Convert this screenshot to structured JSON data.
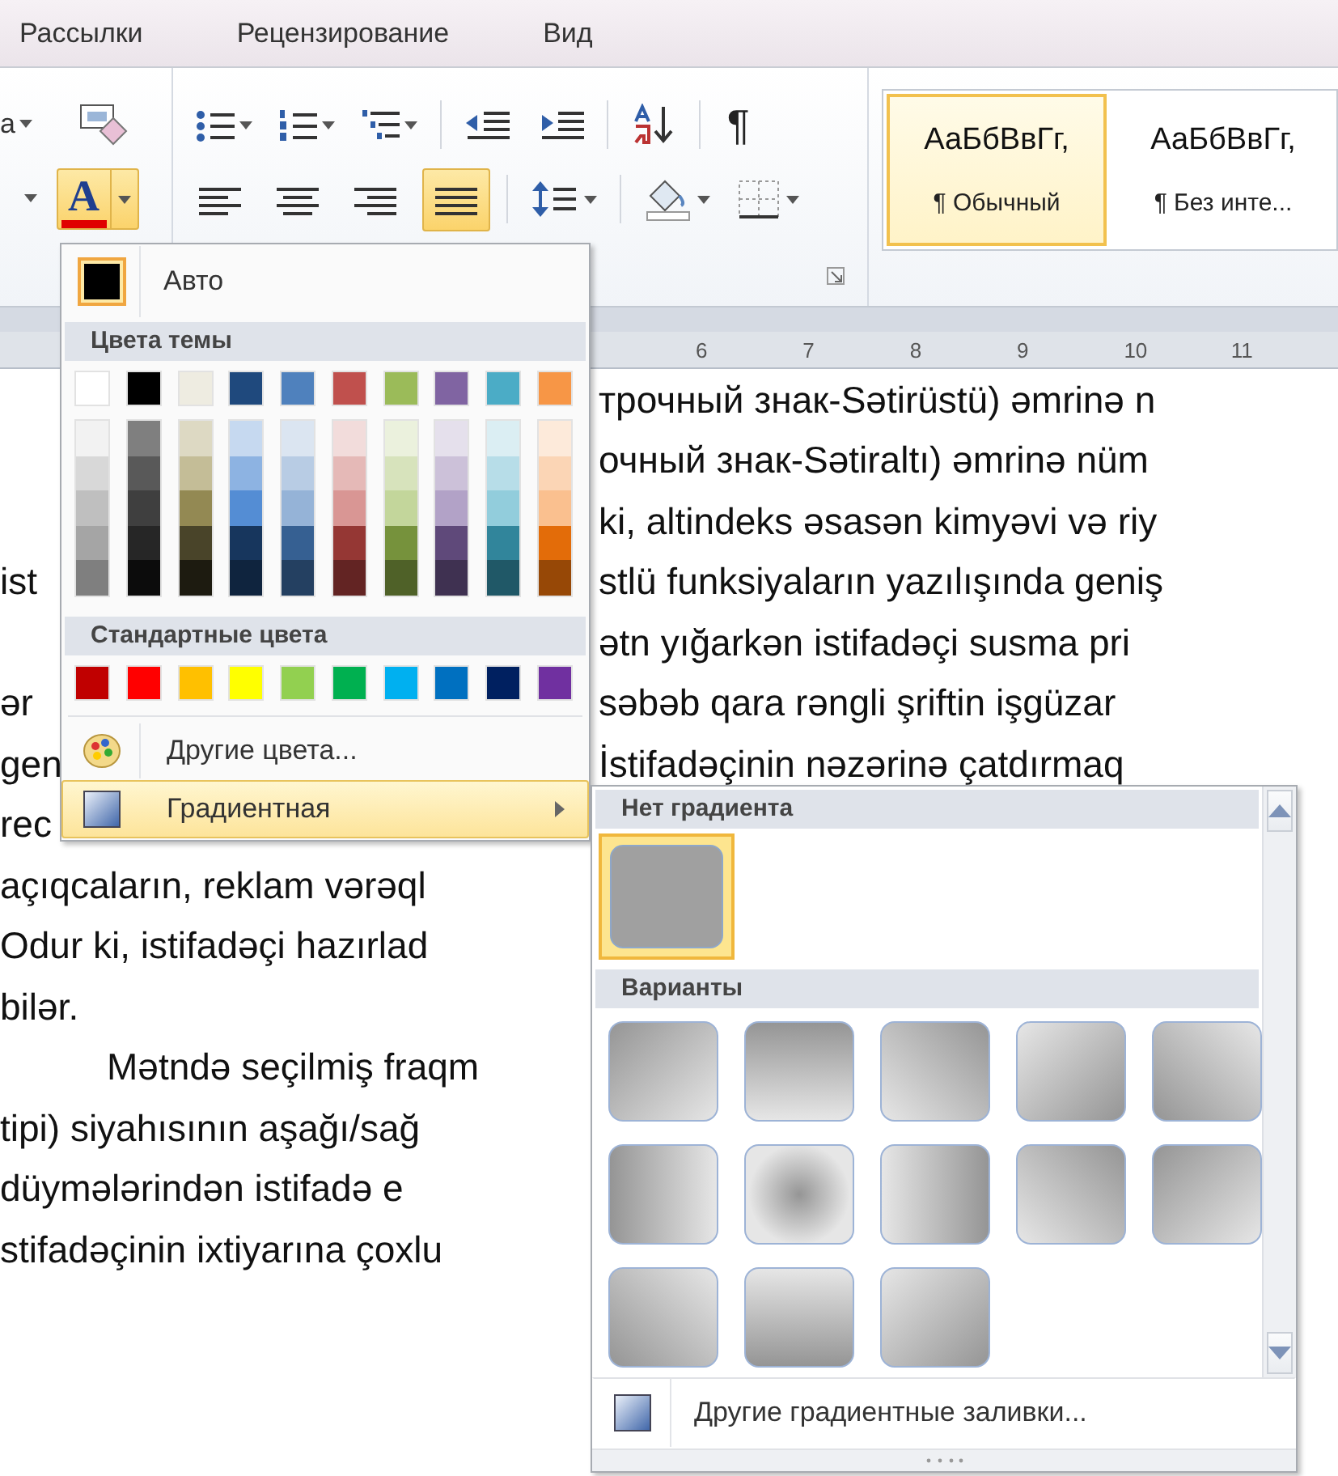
{
  "ribbon_tabs": [
    {
      "label": "Рассылки",
      "selected": false
    },
    {
      "label": "Рецензирование",
      "selected": false
    },
    {
      "label": "Вид",
      "selected": false
    }
  ],
  "ribbon": {
    "font_fragment": "а",
    "font_color_button": {
      "glyph": "A",
      "selected": true
    },
    "pilcrow": "¶",
    "paragraph_align": [
      {
        "kind": "left",
        "selected": false
      },
      {
        "kind": "center",
        "selected": false
      },
      {
        "kind": "right",
        "selected": false
      },
      {
        "kind": "justify",
        "selected": true
      }
    ],
    "styles": [
      {
        "sample": "АаБбВвГг,",
        "name": "¶ Обычный",
        "selected": true
      },
      {
        "sample": "АаБбВвГг,",
        "name": "¶ Без инте...",
        "selected": false
      }
    ]
  },
  "ruler": {
    "numbers": [
      "6",
      "7",
      "8",
      "9",
      "10",
      "11"
    ]
  },
  "document": {
    "lines": [
      {
        "right": "трочный знак-Sətirüstü) əmrinə n"
      },
      {
        "right": "очный знак-Sətiraltı) əmrinə nüm"
      },
      {
        "right": "ki, altindeks əsasən kimyəvi və riy"
      },
      {
        "left": "ist",
        "right": "stlü funksiyaların yazılışında geniş"
      },
      {
        "right": "ətn yığarkən istifadəçi susma pri"
      },
      {
        "left": "ər",
        "right": "səbəb qara rəngli şriftin işgüzar"
      },
      {
        "left": "gen",
        "right": "İstifadəçinin nəzərinə çatdırmaq"
      },
      {
        "left": "rec"
      },
      {
        "left": "açıqcaların, reklam vərəql"
      },
      {
        "left": "Odur ki, istifadəçi hazırlad"
      },
      {
        "left": "bilər."
      },
      {
        "left": "Mətndə seçilmiş fraqm",
        "indent": true
      },
      {
        "left": "tipi) siyahısının aşağı/sağ"
      },
      {
        "left": "düymələrindən istifadə e"
      },
      {
        "left": "stifadəçinin ixtiyarına çoxlu"
      }
    ]
  },
  "color_menu": {
    "auto": {
      "label": "Авто",
      "color": "#000000"
    },
    "theme_header": "Цвета темы",
    "theme_colors": [
      {
        "color": "#ffffff",
        "shades": [
          {
            "color": "#f2f2f2"
          },
          {
            "color": "#d8d8d8"
          },
          {
            "color": "#bfbfbf"
          },
          {
            "color": "#a5a5a5"
          },
          {
            "color": "#7f7f7f"
          }
        ]
      },
      {
        "color": "#000000",
        "shades": [
          {
            "color": "#7f7f7f"
          },
          {
            "color": "#595959"
          },
          {
            "color": "#3f3f3f"
          },
          {
            "color": "#262626"
          },
          {
            "color": "#0c0c0c"
          }
        ]
      },
      {
        "color": "#eeece1",
        "shades": [
          {
            "color": "#ddd9c3"
          },
          {
            "color": "#c4bd97"
          },
          {
            "color": "#938953"
          },
          {
            "color": "#494429"
          },
          {
            "color": "#1d1b10"
          }
        ]
      },
      {
        "color": "#1f497d",
        "shades": [
          {
            "color": "#c6d9f0"
          },
          {
            "color": "#8db3e2"
          },
          {
            "color": "#548dd4"
          },
          {
            "color": "#17365d"
          },
          {
            "color": "#0f243e"
          }
        ]
      },
      {
        "color": "#4f81bd",
        "shades": [
          {
            "color": "#dbe5f1"
          },
          {
            "color": "#b8cce4"
          },
          {
            "color": "#95b3d7"
          },
          {
            "color": "#366092"
          },
          {
            "color": "#244061"
          }
        ]
      },
      {
        "color": "#c0504d",
        "shades": [
          {
            "color": "#f2dcdb"
          },
          {
            "color": "#e5b9b7"
          },
          {
            "color": "#d99694"
          },
          {
            "color": "#953734"
          },
          {
            "color": "#632423"
          }
        ]
      },
      {
        "color": "#9bbb59",
        "shades": [
          {
            "color": "#ebf1dd"
          },
          {
            "color": "#d7e3bc"
          },
          {
            "color": "#c3d69b"
          },
          {
            "color": "#76923c"
          },
          {
            "color": "#4f6128"
          }
        ]
      },
      {
        "color": "#8064a2",
        "shades": [
          {
            "color": "#e5e0ec"
          },
          {
            "color": "#ccc1d9"
          },
          {
            "color": "#b2a2c7"
          },
          {
            "color": "#5f497a"
          },
          {
            "color": "#3f3151"
          }
        ]
      },
      {
        "color": "#4bacc6",
        "shades": [
          {
            "color": "#dbeef3"
          },
          {
            "color": "#b7dde8"
          },
          {
            "color": "#92cddc"
          },
          {
            "color": "#31859b"
          },
          {
            "color": "#205867"
          }
        ]
      },
      {
        "color": "#f79646",
        "shades": [
          {
            "color": "#fdeada"
          },
          {
            "color": "#fbd5b5"
          },
          {
            "color": "#fac08f"
          },
          {
            "color": "#e36c09"
          },
          {
            "color": "#974806"
          }
        ]
      }
    ],
    "standard_header": "Стандартные цвета",
    "standard_colors": [
      {
        "color": "#c00000"
      },
      {
        "color": "#ff0000"
      },
      {
        "color": "#ffc000"
      },
      {
        "color": "#ffff00"
      },
      {
        "color": "#92d050"
      },
      {
        "color": "#00b050"
      },
      {
        "color": "#00b0f0"
      },
      {
        "color": "#0070c0"
      },
      {
        "color": "#002060"
      },
      {
        "color": "#7030a0"
      }
    ],
    "items": [
      {
        "kind": "more",
        "label": "Другие цвета...",
        "selected": false
      },
      {
        "kind": "gradient",
        "label": "Градиентная",
        "selected": true
      }
    ]
  },
  "gradient_menu": {
    "none_header": "Нет градиента",
    "none_selected": true,
    "variants_header": "Варианты",
    "variants": [
      {
        "kind": "nw"
      },
      {
        "kind": "n"
      },
      {
        "kind": "ne"
      },
      {
        "kind": "se"
      },
      {
        "kind": "sw"
      },
      {
        "kind": "w"
      },
      {
        "kind": "center"
      },
      {
        "kind": "e"
      },
      {
        "kind": "ne"
      },
      {
        "kind": "nw"
      },
      {
        "kind": "sw"
      },
      {
        "kind": "s"
      },
      {
        "kind": "se"
      }
    ],
    "more_label": "Другие градиентные заливки..."
  }
}
